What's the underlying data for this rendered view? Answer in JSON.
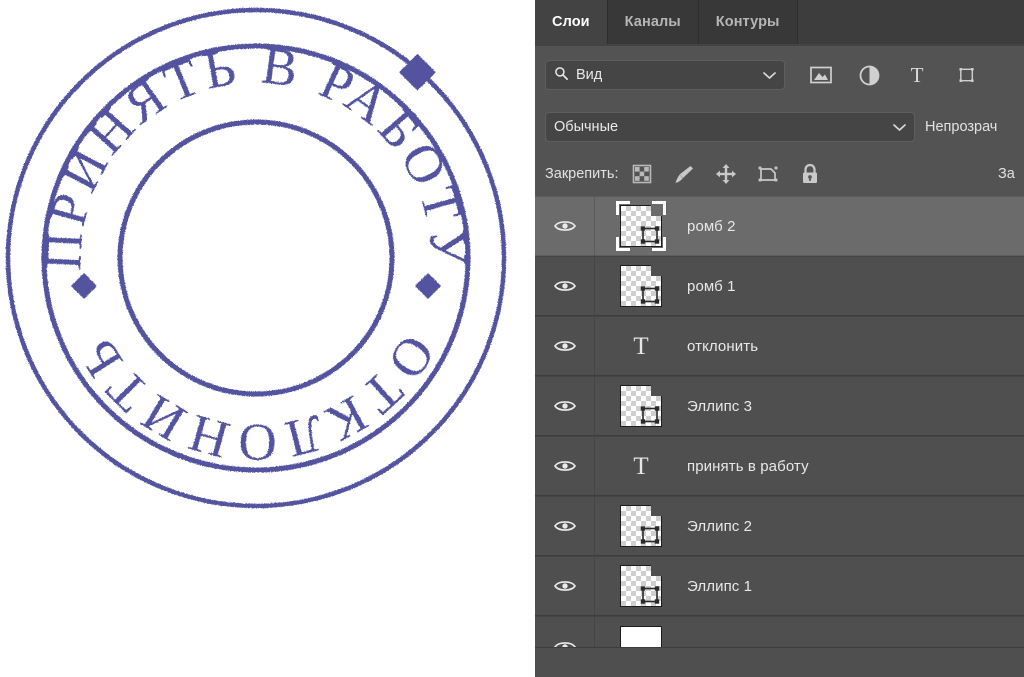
{
  "artwork": {
    "name": "round-stamp",
    "top_text": "ПРИНЯТЬ В РАБОТУ",
    "bottom_text": "ОТКЛОНИТЬ",
    "ink_color": "#5252a0",
    "background_color": "#ffffff"
  },
  "panel": {
    "tabs": [
      {
        "label": "Слои",
        "active": true
      },
      {
        "label": "Каналы",
        "active": false
      },
      {
        "label": "Контуры",
        "active": false
      }
    ],
    "filter": {
      "search_icon": "search-icon",
      "value": "Вид",
      "chevron": "chevron-down-icon",
      "type_icons": [
        "image-layer-filter-icon",
        "adjustment-layer-filter-icon",
        "type-layer-filter-icon",
        "shape-layer-filter-icon"
      ]
    },
    "blend": {
      "mode": "Обычные",
      "chevron": "chevron-down-icon",
      "opacity_label": "Непрозрач"
    },
    "lock": {
      "label": "Закрепить:",
      "icons": [
        "transparent-pixels-lock-icon",
        "image-pixels-lock-icon",
        "position-lock-icon",
        "artboard-nesting-lock-icon",
        "lock-all-icon"
      ],
      "fill_label": "За"
    },
    "layers": [
      {
        "name": "ромб 2",
        "kind": "shape",
        "selected": true,
        "visible": true
      },
      {
        "name": "ромб 1",
        "kind": "shape",
        "selected": false,
        "visible": true
      },
      {
        "name": "отклонить",
        "kind": "text",
        "selected": false,
        "visible": true
      },
      {
        "name": "Эллипс 3",
        "kind": "shape",
        "selected": false,
        "visible": true
      },
      {
        "name": "принять в работу",
        "kind": "text",
        "selected": false,
        "visible": true
      },
      {
        "name": "Эллипс 2",
        "kind": "shape",
        "selected": false,
        "visible": true
      },
      {
        "name": "Эллипс 1",
        "kind": "shape",
        "selected": false,
        "visible": true
      },
      {
        "name": "",
        "kind": "solid",
        "selected": false,
        "visible": true
      }
    ],
    "colors": {
      "panel_bg": "#535353",
      "row_bg": "#4f4f4f",
      "row_selected_bg": "#6b6b6b",
      "tab_bg": "#383838",
      "tab_active_bg": "#434343",
      "text": "#e8e8e8"
    }
  }
}
